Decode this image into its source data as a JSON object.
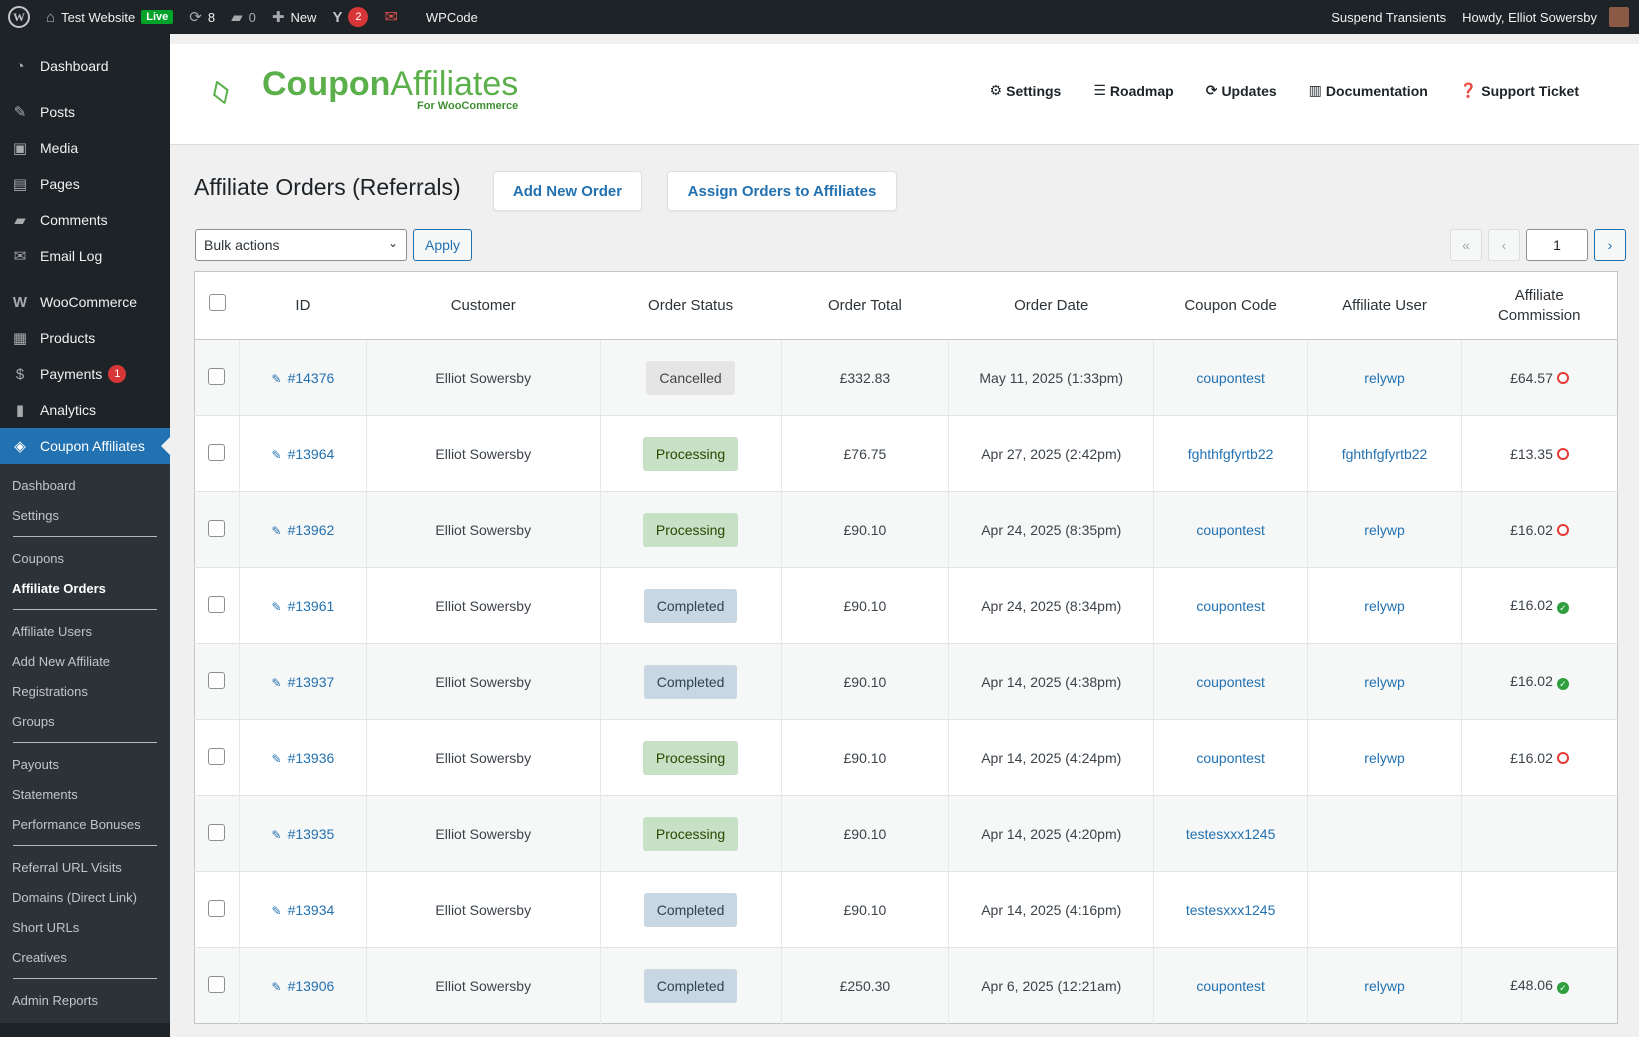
{
  "adminbar": {
    "site_name": "Test Website",
    "live_label": "Live",
    "updates_count": "8",
    "comments_count": "0",
    "new_label": "New",
    "yoast_count": "2",
    "wpcode_label": "WPCode",
    "suspend_label": "Suspend Transients",
    "howdy_label": "Howdy, Elliot Sowersby"
  },
  "sidebar": {
    "items": [
      {
        "label": "Dashboard"
      },
      {
        "label": "Posts"
      },
      {
        "label": "Media"
      },
      {
        "label": "Pages"
      },
      {
        "label": "Comments"
      },
      {
        "label": "Email Log"
      },
      {
        "label": "WooCommerce"
      },
      {
        "label": "Products"
      },
      {
        "label": "Payments",
        "badge": "1"
      },
      {
        "label": "Analytics"
      },
      {
        "label": "Coupon Affiliates"
      }
    ],
    "submenu": [
      "Dashboard",
      "Settings",
      "Coupons",
      "Affiliate Orders",
      "Affiliate Users",
      "Add New Affiliate",
      "Registrations",
      "Groups",
      "Payouts",
      "Statements",
      "Performance Bonuses",
      "Referral URL Visits",
      "Domains (Direct Link)",
      "Short URLs",
      "Creatives",
      "Admin Reports"
    ]
  },
  "header": {
    "logo_bold": "Coupon",
    "logo_light": "Affiliates",
    "logo_sub": "For WooCommerce",
    "nav": [
      "Settings",
      "Roadmap",
      "Updates",
      "Documentation",
      "Support Ticket"
    ]
  },
  "page": {
    "title": "Affiliate Orders (Referrals)",
    "add_new_order": "Add New Order",
    "assign_orders": "Assign Orders to Affiliates",
    "bulk_actions": "Bulk actions",
    "apply": "Apply",
    "current_page": "1"
  },
  "table": {
    "headers": [
      "ID",
      "Customer",
      "Order Status",
      "Order Total",
      "Order Date",
      "Coupon Code",
      "Affiliate User",
      "Affiliate Commission"
    ],
    "rows": [
      {
        "id": "#14376",
        "customer": "Elliot Sowersby",
        "status": "Cancelled",
        "total": "£332.83",
        "date": "May 11, 2025 (1:33pm)",
        "coupon": "coupontest",
        "affiliate": "relywp",
        "commission": "£64.57",
        "comm_state": "pending"
      },
      {
        "id": "#13964",
        "customer": "Elliot Sowersby",
        "status": "Processing",
        "total": "£76.75",
        "date": "Apr 27, 2025 (2:42pm)",
        "coupon": "fghthfgfyrtb22",
        "affiliate": "fghthfgfyrtb22",
        "commission": "£13.35",
        "comm_state": "pending"
      },
      {
        "id": "#13962",
        "customer": "Elliot Sowersby",
        "status": "Processing",
        "total": "£90.10",
        "date": "Apr 24, 2025 (8:35pm)",
        "coupon": "coupontest",
        "affiliate": "relywp",
        "commission": "£16.02",
        "comm_state": "pending"
      },
      {
        "id": "#13961",
        "customer": "Elliot Sowersby",
        "status": "Completed",
        "total": "£90.10",
        "date": "Apr 24, 2025 (8:34pm)",
        "coupon": "coupontest",
        "affiliate": "relywp",
        "commission": "£16.02",
        "comm_state": "paid"
      },
      {
        "id": "#13937",
        "customer": "Elliot Sowersby",
        "status": "Completed",
        "total": "£90.10",
        "date": "Apr 14, 2025 (4:38pm)",
        "coupon": "coupontest",
        "affiliate": "relywp",
        "commission": "£16.02",
        "comm_state": "paid"
      },
      {
        "id": "#13936",
        "customer": "Elliot Sowersby",
        "status": "Processing",
        "total": "£90.10",
        "date": "Apr 14, 2025 (4:24pm)",
        "coupon": "coupontest",
        "affiliate": "relywp",
        "commission": "£16.02",
        "comm_state": "pending"
      },
      {
        "id": "#13935",
        "customer": "Elliot Sowersby",
        "status": "Processing",
        "total": "£90.10",
        "date": "Apr 14, 2025 (4:20pm)",
        "coupon": "testesxxx1245",
        "affiliate": "",
        "commission": "",
        "comm_state": ""
      },
      {
        "id": "#13934",
        "customer": "Elliot Sowersby",
        "status": "Completed",
        "total": "£90.10",
        "date": "Apr 14, 2025 (4:16pm)",
        "coupon": "testesxxx1245",
        "affiliate": "",
        "commission": "",
        "comm_state": ""
      },
      {
        "id": "#13906",
        "customer": "Elliot Sowersby",
        "status": "Completed",
        "total": "£250.30",
        "date": "Apr 6, 2025 (12:21am)",
        "coupon": "coupontest",
        "affiliate": "relywp",
        "commission": "£48.06",
        "comm_state": "paid"
      }
    ]
  }
}
